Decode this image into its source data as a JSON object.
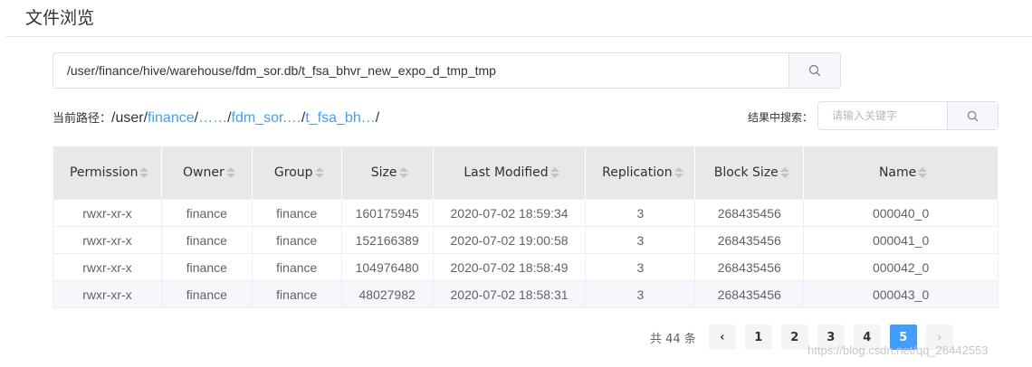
{
  "page": {
    "title": "文件浏览"
  },
  "path_search": {
    "value": "/user/finance/hive/warehouse/fdm_sor.db/t_fsa_bhvr_new_expo_d_tmp_tmp"
  },
  "breadcrumb": {
    "label": "当前路径：",
    "segments": [
      "/user/",
      "finance",
      "/",
      "……",
      "/",
      "fdm_sor.…",
      "/",
      "t_fsa_bh…",
      "/"
    ]
  },
  "keyword_search": {
    "label": "结果中搜索：",
    "placeholder": "请输入关键字"
  },
  "table": {
    "columns": [
      "Permission",
      "Owner",
      "Group",
      "Size",
      "Last Modified",
      "Replication",
      "Block Size",
      "Name"
    ],
    "rows": [
      [
        "rwxr-xr-x",
        "finance",
        "finance",
        "160175945",
        "2020-07-02 18:59:34",
        "3",
        "268435456",
        "000040_0"
      ],
      [
        "rwxr-xr-x",
        "finance",
        "finance",
        "152166389",
        "2020-07-02 19:00:58",
        "3",
        "268435456",
        "000041_0"
      ],
      [
        "rwxr-xr-x",
        "finance",
        "finance",
        "104976480",
        "2020-07-02 18:58:49",
        "3",
        "268435456",
        "000042_0"
      ],
      [
        "rwxr-xr-x",
        "finance",
        "finance",
        "48027982",
        "2020-07-02 18:58:31",
        "3",
        "268435456",
        "000043_0"
      ]
    ]
  },
  "pagination": {
    "total": "共 44 条",
    "prev": "‹",
    "next": "›",
    "pages": [
      "1",
      "2",
      "3",
      "4",
      "5"
    ],
    "current": "5"
  },
  "watermark": "https://blog.csdn.net/qq_26442553",
  "colors": {
    "accent": "#409eff",
    "header_bg": "#e8e8eb",
    "stripe": "#f5f7fa"
  },
  "icons": {
    "search": "search-icon",
    "sort": "sort-icon",
    "prev": "chevron-left-icon",
    "next": "chevron-right-icon"
  }
}
